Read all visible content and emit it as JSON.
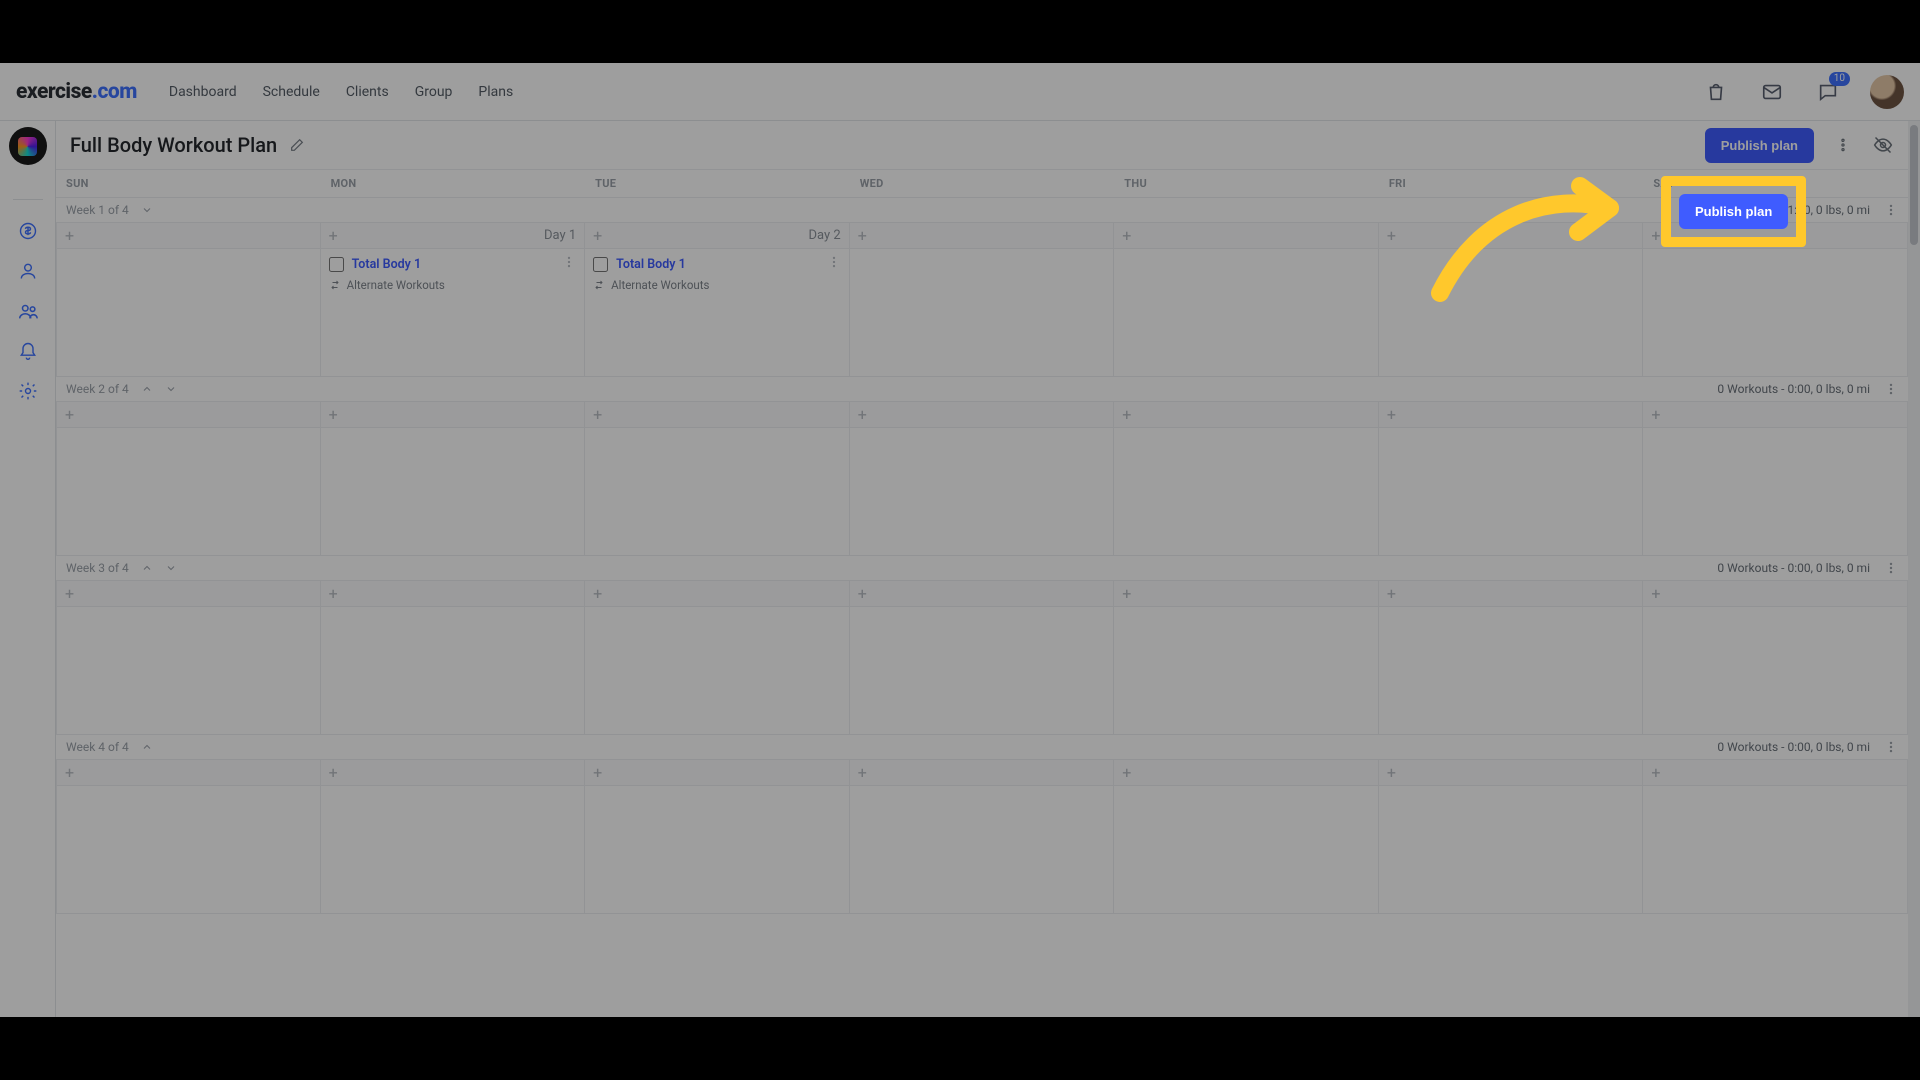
{
  "brand": {
    "name": "exercise",
    "suffix": ".com"
  },
  "nav": {
    "links": [
      "Dashboard",
      "Schedule",
      "Clients",
      "Group",
      "Plans"
    ],
    "notification_count": "10"
  },
  "plan": {
    "title": "Full Body Workout Plan",
    "publish_label": "Publish plan"
  },
  "days": [
    "SUN",
    "MON",
    "TUE",
    "WED",
    "THU",
    "FRI",
    "SAT"
  ],
  "weeks": [
    {
      "label": "Week 1 of 4",
      "summary": "2 Workouts - 11:30, 0 lbs, 0 mi",
      "collapsed_only_down": true,
      "cells": [
        {
          "day_label": ""
        },
        {
          "day_label": "Day 1",
          "workout": "Total Body 1",
          "alt": "Alternate Workouts"
        },
        {
          "day_label": "Day 2",
          "workout": "Total Body 1",
          "alt": "Alternate Workouts"
        },
        {
          "day_label": ""
        },
        {
          "day_label": ""
        },
        {
          "day_label": ""
        },
        {
          "day_label": ""
        }
      ]
    },
    {
      "label": "Week 2 of 4",
      "summary": "0 Workouts - 0:00, 0 lbs, 0 mi",
      "cells": [
        {},
        {},
        {},
        {},
        {},
        {},
        {}
      ]
    },
    {
      "label": "Week 3 of 4",
      "summary": "0 Workouts - 0:00, 0 lbs, 0 mi",
      "cells": [
        {},
        {},
        {},
        {},
        {},
        {},
        {}
      ]
    },
    {
      "label": "Week 4 of 4",
      "summary": "0 Workouts - 0:00, 0 lbs, 0 mi",
      "collapsed_only_up": true,
      "cells": [
        {},
        {},
        {},
        {},
        {},
        {},
        {}
      ]
    }
  ]
}
